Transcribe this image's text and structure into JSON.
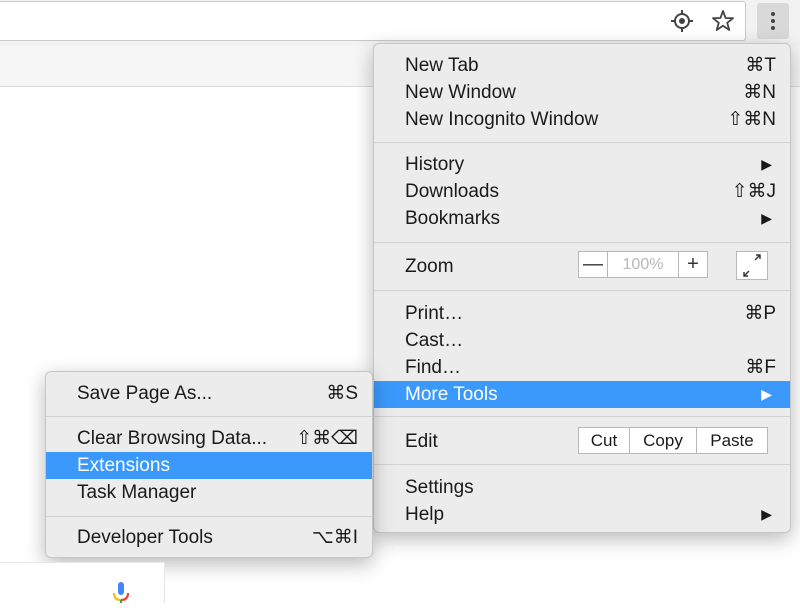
{
  "toolbar": {
    "icons": [
      "location-icon",
      "star-icon",
      "menu-dots-icon"
    ]
  },
  "main_menu": {
    "groups": [
      [
        {
          "label": "New Tab",
          "shortcut": "⌘T"
        },
        {
          "label": "New Window",
          "shortcut": "⌘N"
        },
        {
          "label": "New Incognito Window",
          "shortcut": "⇧⌘N"
        }
      ],
      [
        {
          "label": "History",
          "shortcut": "▶"
        },
        {
          "label": "Downloads",
          "shortcut": "⇧⌘J"
        },
        {
          "label": "Bookmarks",
          "shortcut": "▶"
        }
      ],
      [
        {
          "label": "Zoom"
        }
      ],
      [
        {
          "label": "Print…",
          "shortcut": "⌘P"
        },
        {
          "label": "Cast…",
          "shortcut": ""
        },
        {
          "label": "Find…",
          "shortcut": "⌘F"
        },
        {
          "label": "More Tools",
          "shortcut": "▶",
          "highlighted": true
        }
      ],
      [
        {
          "label": "Edit"
        }
      ],
      [
        {
          "label": "Settings",
          "shortcut": ""
        },
        {
          "label": "Help",
          "shortcut": "▶"
        }
      ]
    ],
    "zoom": {
      "minus": "—",
      "value": "100%",
      "plus": "+"
    },
    "edit": {
      "cut": "Cut",
      "copy": "Copy",
      "paste": "Paste"
    }
  },
  "sub_menu": {
    "items": [
      {
        "label": "Save Page As...",
        "shortcut": "⌘S"
      },
      {
        "label": "Clear Browsing Data...",
        "shortcut": "⇧⌘⌫"
      },
      {
        "label": "Extensions",
        "shortcut": "",
        "highlighted": true
      },
      {
        "label": "Task Manager",
        "shortcut": ""
      },
      {
        "label": "Developer Tools",
        "shortcut": "⌥⌘I"
      }
    ]
  },
  "colors": {
    "highlight": "#3b99fc",
    "menu_bg": "#ececec",
    "mic_blue": "#4285f4",
    "mic_red": "#ea4335",
    "mic_yellow": "#fbbc05",
    "mic_green": "#34a853"
  }
}
